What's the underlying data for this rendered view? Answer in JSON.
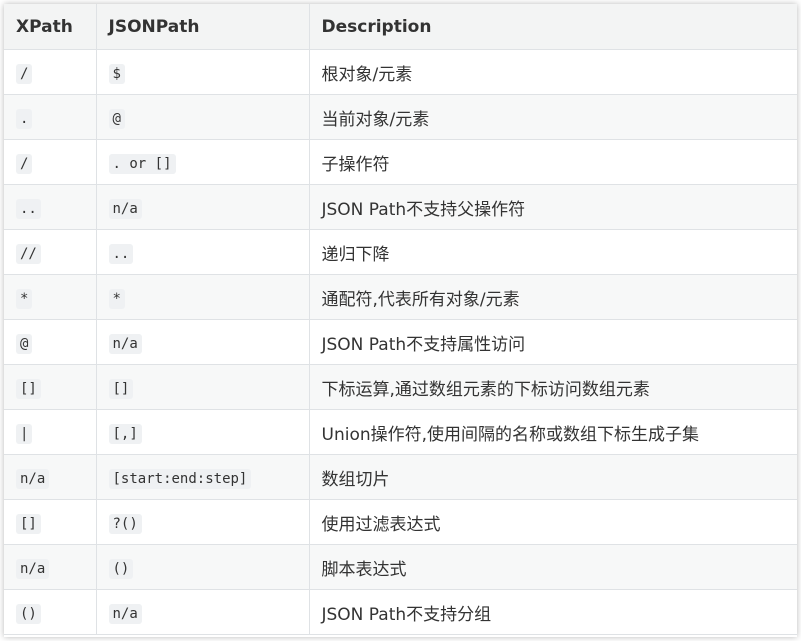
{
  "table": {
    "headers": [
      "XPath",
      "JSONPath",
      "Description"
    ],
    "rows": [
      {
        "xpath": "/",
        "jsonpath": "$",
        "description": "根对象/元素"
      },
      {
        "xpath": ".",
        "jsonpath": "@",
        "description": "当前对象/元素"
      },
      {
        "xpath": "/",
        "jsonpath": ". or []",
        "description": "子操作符"
      },
      {
        "xpath": "..",
        "jsonpath": "n/a",
        "description": "JSON Path不支持父操作符"
      },
      {
        "xpath": "//",
        "jsonpath": "..",
        "description": "递归下降"
      },
      {
        "xpath": "*",
        "jsonpath": "*",
        "description": "通配符,代表所有对象/元素"
      },
      {
        "xpath": "@",
        "jsonpath": "n/a",
        "description": "JSON Path不支持属性访问"
      },
      {
        "xpath": "[]",
        "jsonpath": "[]",
        "description": "下标运算,通过数组元素的下标访问数组元素"
      },
      {
        "xpath": "|",
        "jsonpath": "[,]",
        "description": "Union操作符,使用间隔的名称或数组下标生成子集"
      },
      {
        "xpath": "n/a",
        "jsonpath": "[start:end:step]",
        "description": "数组切片"
      },
      {
        "xpath": "[]",
        "jsonpath": "?()",
        "description": "使用过滤表达式"
      },
      {
        "xpath": "n/a",
        "jsonpath": "()",
        "description": "脚本表达式"
      },
      {
        "xpath": "()",
        "jsonpath": "n/a",
        "description": "JSON Path不支持分组"
      }
    ]
  },
  "colors": {
    "header_bg": "#f3f4f4",
    "row_alt_bg": "#f7f8f8",
    "border": "#dfe2e5",
    "code_bg": "#eff1f3",
    "text": "#333333"
  }
}
